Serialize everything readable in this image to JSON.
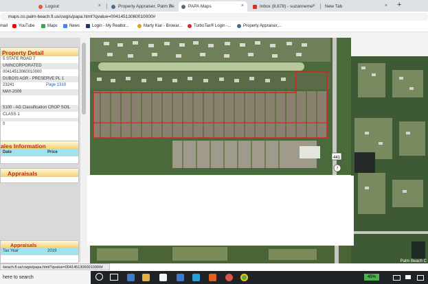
{
  "tabs": [
    {
      "label": "Logout",
      "active": false,
      "favicon_color": "#e0563b"
    },
    {
      "label": "Property Appraiser, Palm Be",
      "active": false,
      "favicon_color": "#4a6a8a"
    },
    {
      "label": "PAPA Maps",
      "active": true,
      "favicon_color": "#4a6a8a"
    },
    {
      "label": "Inbox (8,678) - suzanneme",
      "active": false,
      "favicon_color": "#d93025"
    },
    {
      "label": "New Tab",
      "active": false,
      "favicon_color": "#9aa0a6"
    }
  ],
  "new_tab_symbol": "+",
  "close_symbol": "×",
  "address_bar": {
    "url": "maps.co.palm-beach.fl.us/cwgis/papa.html?qvalue=00414513060010000#"
  },
  "bookmarks": [
    {
      "label": "mail",
      "icon": "mail-icon",
      "color": "#d93025"
    },
    {
      "label": "YouTube",
      "icon": "youtube-icon",
      "color": "#ff0000"
    },
    {
      "label": "Maps",
      "icon": "maps-icon",
      "color": "#34a853"
    },
    {
      "label": "News",
      "icon": "news-icon",
      "color": "#4285f4"
    },
    {
      "label": "Login - My Realtor...",
      "icon": "realtor-icon",
      "color": "#1b3a6b"
    },
    {
      "label": "Marty Kiar - Browar...",
      "icon": "person-icon",
      "color": "#e0a020"
    },
    {
      "label": "TurboTax® Login -...",
      "icon": "turbotax-icon",
      "color": "#d52b1e"
    },
    {
      "label": "Property Appraiser,...",
      "icon": "appraiser-icon",
      "color": "#4a6a8a"
    }
  ],
  "property_detail": {
    "heading": "Property Detail",
    "location": "5 STATE ROAD 7",
    "municipality": "UNINCORPORATED",
    "pcn": "00414513060010000",
    "subdivision": "DUBOIS AGR - PRESERVE PL 1",
    "book": "23241",
    "page_label": "Page 1310",
    "sale_date": "MAY-2009",
    "use_code": "5100 - AG Classification CROP SOIL",
    "use_code2": "CLASS 1",
    "zero": "0"
  },
  "sales_information": {
    "heading": "ales Information",
    "col_date": "Date",
    "col_price": "Price"
  },
  "appraisals": {
    "heading": "Appraisals",
    "sub_heading": "Appraisals",
    "tax_year_label": "Tax Year",
    "tax_year_value": "2019"
  },
  "map": {
    "road_shield": "441",
    "shield2": "7",
    "credit": "Palm Beach C",
    "parcel_outline_color": "#e02020"
  },
  "status_link": "-beach.fl.us/cwgis/papa.html?qvalue=00414513060010000#",
  "taskbar": {
    "search_placeholder": "here to search",
    "battery": "45%"
  }
}
